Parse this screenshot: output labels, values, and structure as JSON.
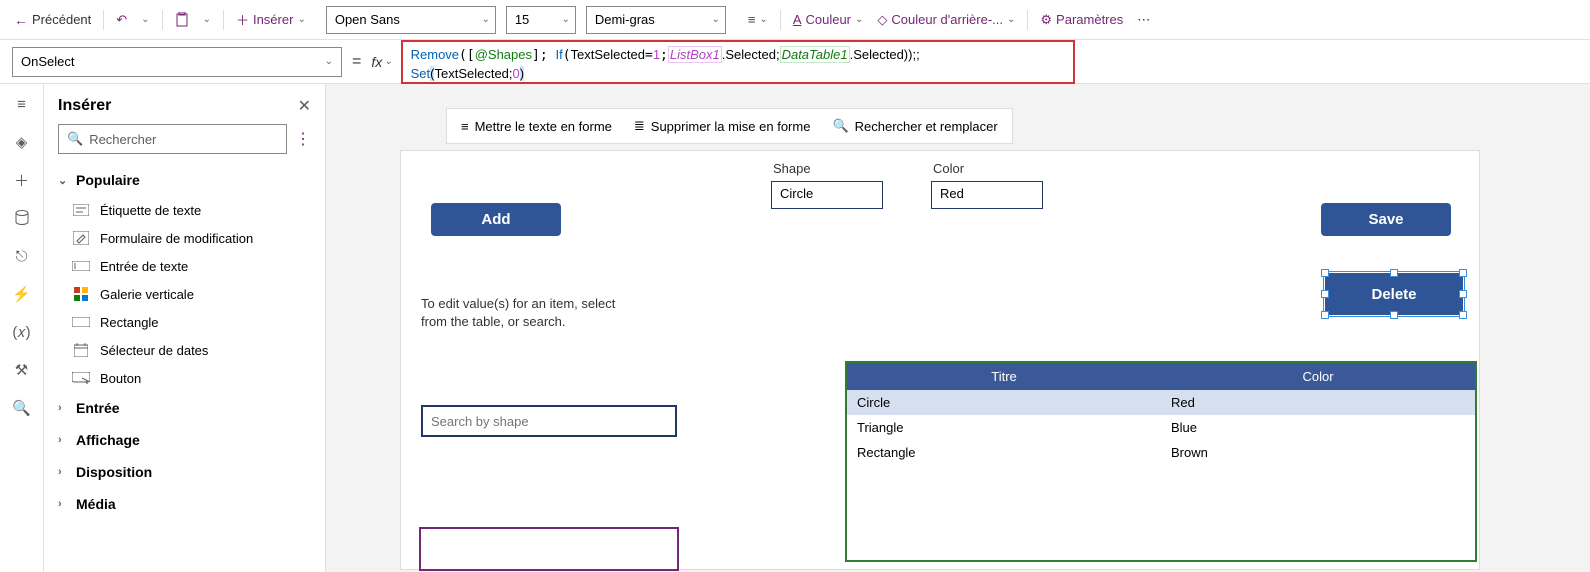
{
  "toolbar": {
    "back": "Précédent",
    "insert": "Insérer",
    "font_name": "Open Sans",
    "font_size": "15",
    "font_weight": "Demi-gras",
    "color": "Couleur",
    "bgcolor": "Couleur d'arrière-...",
    "settings": "Paramètres"
  },
  "property_row": {
    "property": "OnSelect",
    "formula_tokens": {
      "remove": "Remove",
      "shapes": "@Shapes",
      "if": "If",
      "textsel": "TextSelected",
      "eq1": "1",
      "listbox": "ListBox1",
      "selected1": ".Selected;",
      "datatable": "DataTable1",
      "selected2": ".Selected));;",
      "set": "Set",
      "textsel2": "TextSelected;",
      "zero": "0"
    }
  },
  "canvas_bar": {
    "format": "Mettre le texte en forme",
    "clear": "Supprimer la mise en forme",
    "find": "Rechercher et remplacer"
  },
  "insert_panel": {
    "title": "Insérer",
    "search_placeholder": "Rechercher",
    "cat_popular": "Populaire",
    "items": [
      "Étiquette de texte",
      "Formulaire de modification",
      "Entrée de texte",
      "Galerie verticale",
      "Rectangle",
      "Sélecteur de dates",
      "Bouton"
    ],
    "cat_input": "Entrée",
    "cat_display": "Affichage",
    "cat_layout": "Disposition",
    "cat_media": "Média"
  },
  "canvas": {
    "add": "Add",
    "save": "Save",
    "delete": "Delete",
    "shape_label": "Shape",
    "color_label": "Color",
    "shape_value": "Circle",
    "color_value": "Red",
    "helper": "To edit value(s) for an item, select from the table, or search.",
    "search_placeholder": "Search by shape",
    "table": {
      "col1": "Titre",
      "col2": "Color",
      "rows": [
        {
          "t": "Circle",
          "c": "Red"
        },
        {
          "t": "Triangle",
          "c": "Blue"
        },
        {
          "t": "Rectangle",
          "c": "Brown"
        }
      ]
    }
  }
}
